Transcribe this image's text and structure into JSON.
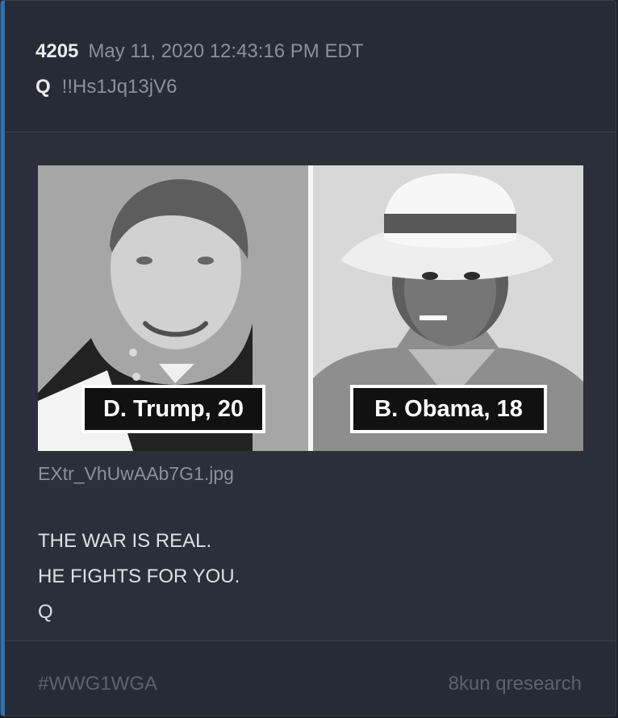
{
  "post": {
    "number": "4205",
    "date": "May 11, 2020 12:43:16 PM EDT",
    "author": "Q",
    "tripcode": "!!Hs1Jq13jV6"
  },
  "image": {
    "left_caption": "D. Trump, 20",
    "right_caption": "B. Obama, 18",
    "filename": "EXtr_VhUwAAb7G1.jpg"
  },
  "message": {
    "lines": [
      "THE WAR IS REAL.",
      "HE FIGHTS FOR YOU.",
      "Q"
    ]
  },
  "footer": {
    "hashtag": "#WWG1WGA",
    "source": "8kun qresearch"
  },
  "colors": {
    "background": "#2b2f3a",
    "accent": "#2f6fb3",
    "text": "#dde0e6",
    "muted": "#8b909c"
  }
}
